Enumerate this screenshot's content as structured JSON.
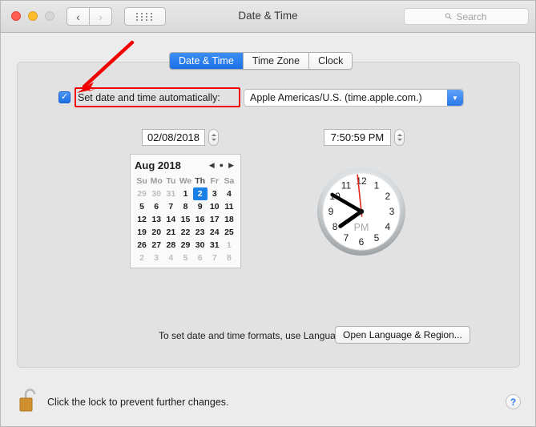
{
  "window": {
    "title": "Date & Time",
    "traffic_lights": [
      "close",
      "minimize",
      "maximize"
    ],
    "nav_back": "‹",
    "nav_forward": "›",
    "grid_button": "show-all-grid"
  },
  "search": {
    "placeholder": "Search",
    "icon": "search-icon"
  },
  "tabs": [
    {
      "label": "Date & Time",
      "active": true
    },
    {
      "label": "Time Zone",
      "active": false
    },
    {
      "label": "Clock",
      "active": false
    }
  ],
  "auto_set": {
    "checked": true,
    "check_glyph": "✓",
    "label": "Set date and time automatically:",
    "highlight_color": "#f20000"
  },
  "server": {
    "value": "Apple Americas/U.S. (time.apple.com.)",
    "arrow_glyph": "▼",
    "accent_color": "#2a78e8"
  },
  "date_field": {
    "value": "02/08/2018",
    "stepper": "date-stepper"
  },
  "time_field": {
    "value": "7:50:59 PM",
    "stepper": "time-stepper"
  },
  "calendar": {
    "month_label": "Aug 2018",
    "nav_prev": "◀",
    "nav_today": "●",
    "nav_next": "▶",
    "day_headers": [
      "Su",
      "Mo",
      "Tu",
      "We",
      "Th",
      "Fr",
      "Sa"
    ],
    "highlighted_header_index": 4,
    "selected_day": 2,
    "weeks": [
      [
        {
          "d": "29",
          "out": true
        },
        {
          "d": "30",
          "out": true
        },
        {
          "d": "31",
          "out": true
        },
        {
          "d": "1",
          "out": false
        },
        {
          "d": "2",
          "out": false,
          "sel": true
        },
        {
          "d": "3",
          "out": false
        },
        {
          "d": "4",
          "out": false
        }
      ],
      [
        {
          "d": "5",
          "out": false
        },
        {
          "d": "6",
          "out": false
        },
        {
          "d": "7",
          "out": false
        },
        {
          "d": "8",
          "out": false
        },
        {
          "d": "9",
          "out": false
        },
        {
          "d": "10",
          "out": false
        },
        {
          "d": "11",
          "out": false
        }
      ],
      [
        {
          "d": "12",
          "out": false
        },
        {
          "d": "13",
          "out": false
        },
        {
          "d": "14",
          "out": false
        },
        {
          "d": "15",
          "out": false
        },
        {
          "d": "16",
          "out": false
        },
        {
          "d": "17",
          "out": false
        },
        {
          "d": "18",
          "out": false
        }
      ],
      [
        {
          "d": "19",
          "out": false
        },
        {
          "d": "20",
          "out": false
        },
        {
          "d": "21",
          "out": false
        },
        {
          "d": "22",
          "out": false
        },
        {
          "d": "23",
          "out": false
        },
        {
          "d": "24",
          "out": false
        },
        {
          "d": "25",
          "out": false
        }
      ],
      [
        {
          "d": "26",
          "out": false
        },
        {
          "d": "27",
          "out": false
        },
        {
          "d": "28",
          "out": false
        },
        {
          "d": "29",
          "out": false
        },
        {
          "d": "30",
          "out": false
        },
        {
          "d": "31",
          "out": false
        },
        {
          "d": "1",
          "out": true
        }
      ],
      [
        {
          "d": "2",
          "out": true
        },
        {
          "d": "3",
          "out": true
        },
        {
          "d": "4",
          "out": true
        },
        {
          "d": "5",
          "out": true
        },
        {
          "d": "6",
          "out": true
        },
        {
          "d": "7",
          "out": true
        },
        {
          "d": "8",
          "out": true
        }
      ]
    ]
  },
  "clock": {
    "meridiem": "PM",
    "hour_numbers": [
      "12",
      "1",
      "2",
      "3",
      "4",
      "5",
      "6",
      "7",
      "8",
      "9",
      "10",
      "11"
    ],
    "hour_hand_deg": 235,
    "minute_hand_deg": 300,
    "second_hand_deg": 354,
    "second_hand_color": "#e8271b"
  },
  "footer_note": {
    "text": "To set date and time formats, use Language & Region preferences.",
    "button_label": "Open Language & Region..."
  },
  "lock": {
    "icon": "unlocked-padlock-icon",
    "text": "Click the lock to prevent further changes."
  },
  "help": {
    "label": "?",
    "icon": "help-icon"
  }
}
